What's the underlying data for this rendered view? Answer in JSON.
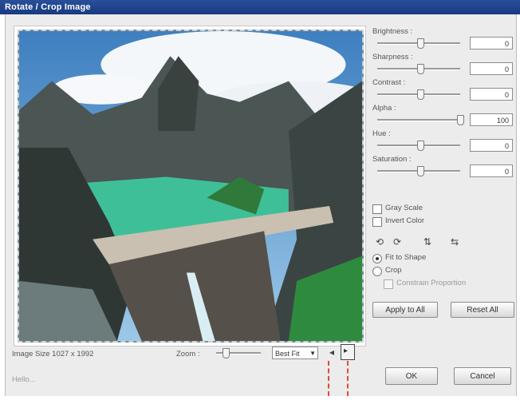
{
  "window": {
    "title": "Rotate / Crop Image"
  },
  "adjustments": [
    {
      "label": "Brightness :",
      "value": "0",
      "level": 0.5
    },
    {
      "label": "Sharpness :",
      "value": "0",
      "level": 0.5
    },
    {
      "label": "Contrast :",
      "value": "0",
      "level": 0.5
    },
    {
      "label": "Alpha :",
      "value": "100",
      "level": 1.0
    },
    {
      "label": "Hue :",
      "value": "0",
      "level": 0.5
    },
    {
      "label": "Saturation :",
      "value": "0",
      "level": 0.5
    }
  ],
  "options": {
    "grayscale": "Gray Scale",
    "invert": "Invert Color"
  },
  "tools": [
    "rotate-left-icon",
    "rotate-right-icon",
    "flip-vertical-icon",
    "flip-horizontal-icon"
  ],
  "fit": {
    "fit_to_shape": "Fit to Shape",
    "crop": "Crop",
    "constrain": "Constrain Proportion",
    "selected": "fit_to_shape"
  },
  "buttons": {
    "apply_all": "Apply to All",
    "reset_all": "Reset All",
    "ok": "OK",
    "cancel": "Cancel"
  },
  "status": {
    "image_size": "Image Size 1027 x 1992",
    "zoom_label": "Zoom :",
    "zoom_value": "Best Fit",
    "hint": "Hello..."
  }
}
